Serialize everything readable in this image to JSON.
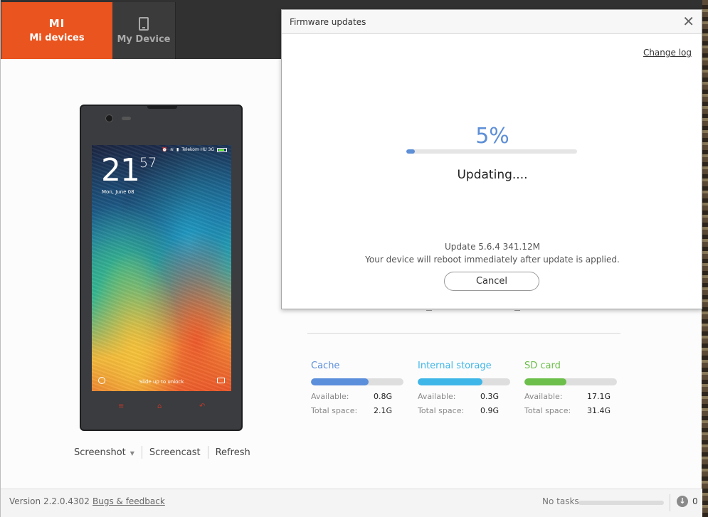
{
  "nav": {
    "active": {
      "logo": "MI",
      "label": "Mi devices"
    },
    "inactive": {
      "label": "My Device"
    }
  },
  "phone": {
    "status_carrier": "Telekom HU 3G",
    "clock_hour": "21",
    "clock_min": "57",
    "date": "Mon, June 08",
    "unlock_text": "Slide up to unlock"
  },
  "phone_actions": {
    "screenshot": "Screenshot",
    "screencast": "Screencast",
    "refresh": "Refresh"
  },
  "storage": [
    {
      "title": "Cache",
      "color": "#5b8edb",
      "fill": 0.62,
      "available_label": "Available:",
      "available": "0.8G",
      "total_label": "Total space:",
      "total": "2.1G"
    },
    {
      "title": "Internal storage",
      "color": "#3fb6e8",
      "fill": 0.7,
      "available_label": "Available:",
      "available": "0.3G",
      "total_label": "Total space:",
      "total": "0.9G"
    },
    {
      "title": "SD card",
      "color": "#6cbf4a",
      "fill": 0.45,
      "available_label": "Available:",
      "available": "17.1G",
      "total_label": "Total space:",
      "total": "31.4G"
    }
  ],
  "footer": {
    "version": "Version 2.2.0.4302",
    "bugs": "Bugs & feedback",
    "no_tasks": "No tasks",
    "download_count": "0"
  },
  "dialog": {
    "title": "Firmware updates",
    "changelog": "Change log",
    "percent_text": "5%",
    "progress": 0.05,
    "status": "Updating....",
    "update_info": "Update 5.6.4 341.12M",
    "update_note": "Your device will reboot immediately after update is applied.",
    "cancel": "Cancel"
  },
  "colors": {
    "accent": "#e9541f",
    "progress": "#5d8fd6"
  }
}
